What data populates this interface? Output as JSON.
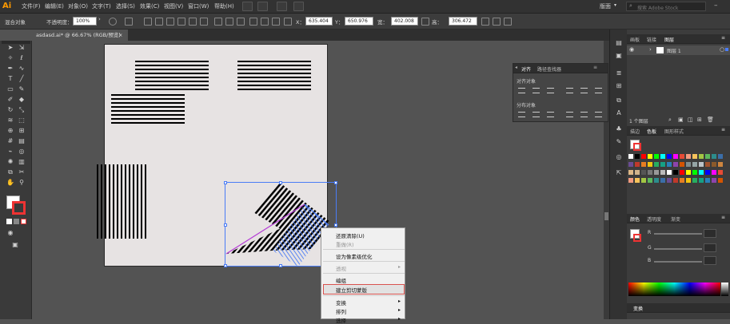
{
  "app": {
    "logo": "Ai"
  },
  "menubar": {
    "items": [
      "文件(F)",
      "编辑(E)",
      "对象(O)",
      "文字(T)",
      "选择(S)",
      "效果(C)",
      "视图(V)",
      "窗口(W)",
      "帮助(H)"
    ],
    "workspace": "版面",
    "search_placeholder": "搜索 Adobe Stock"
  },
  "control_bar": {
    "selection_label": "混合对象",
    "opacity_label": "不透明度：",
    "opacity_value": "100%",
    "x_label": "X：",
    "x_value": "635.404",
    "y_label": "Y：",
    "y_value": "650.976",
    "w_label": "宽：",
    "w_value": "402.008",
    "h_label": "高：",
    "h_value": "306.472"
  },
  "document": {
    "tab_title": "asdasd.ai* @ 66.67% (RGB/预览)",
    "close": "×"
  },
  "align_panel": {
    "tabs": [
      "对齐",
      "路径查找器"
    ],
    "section1": "对齐对象",
    "section2": "分布对象"
  },
  "layers_panel": {
    "tabs": [
      "画板",
      "链接",
      "图层"
    ],
    "layer_name": "图层 1",
    "footer": "1 个图层"
  },
  "swatches_panel": {
    "tabs": [
      "描边",
      "色板",
      "图形样式"
    ]
  },
  "color_panel": {
    "tabs": [
      "颜色",
      "透明度",
      "渐变"
    ],
    "channels": [
      "R",
      "G",
      "B"
    ]
  },
  "transform_panel": {
    "title": "变换"
  },
  "context_menu": {
    "items": [
      "还原清除(U)",
      "重做(R)",
      "设为像素级优化",
      "透视",
      "编组",
      "建立剪切蒙版",
      "变换",
      "排列",
      "选择"
    ],
    "highlighted": "建立剪切蒙版"
  },
  "colors": {
    "accent": "#ff9a00",
    "selection": "#4a7cf6",
    "highlight_border": "#d9534f"
  }
}
